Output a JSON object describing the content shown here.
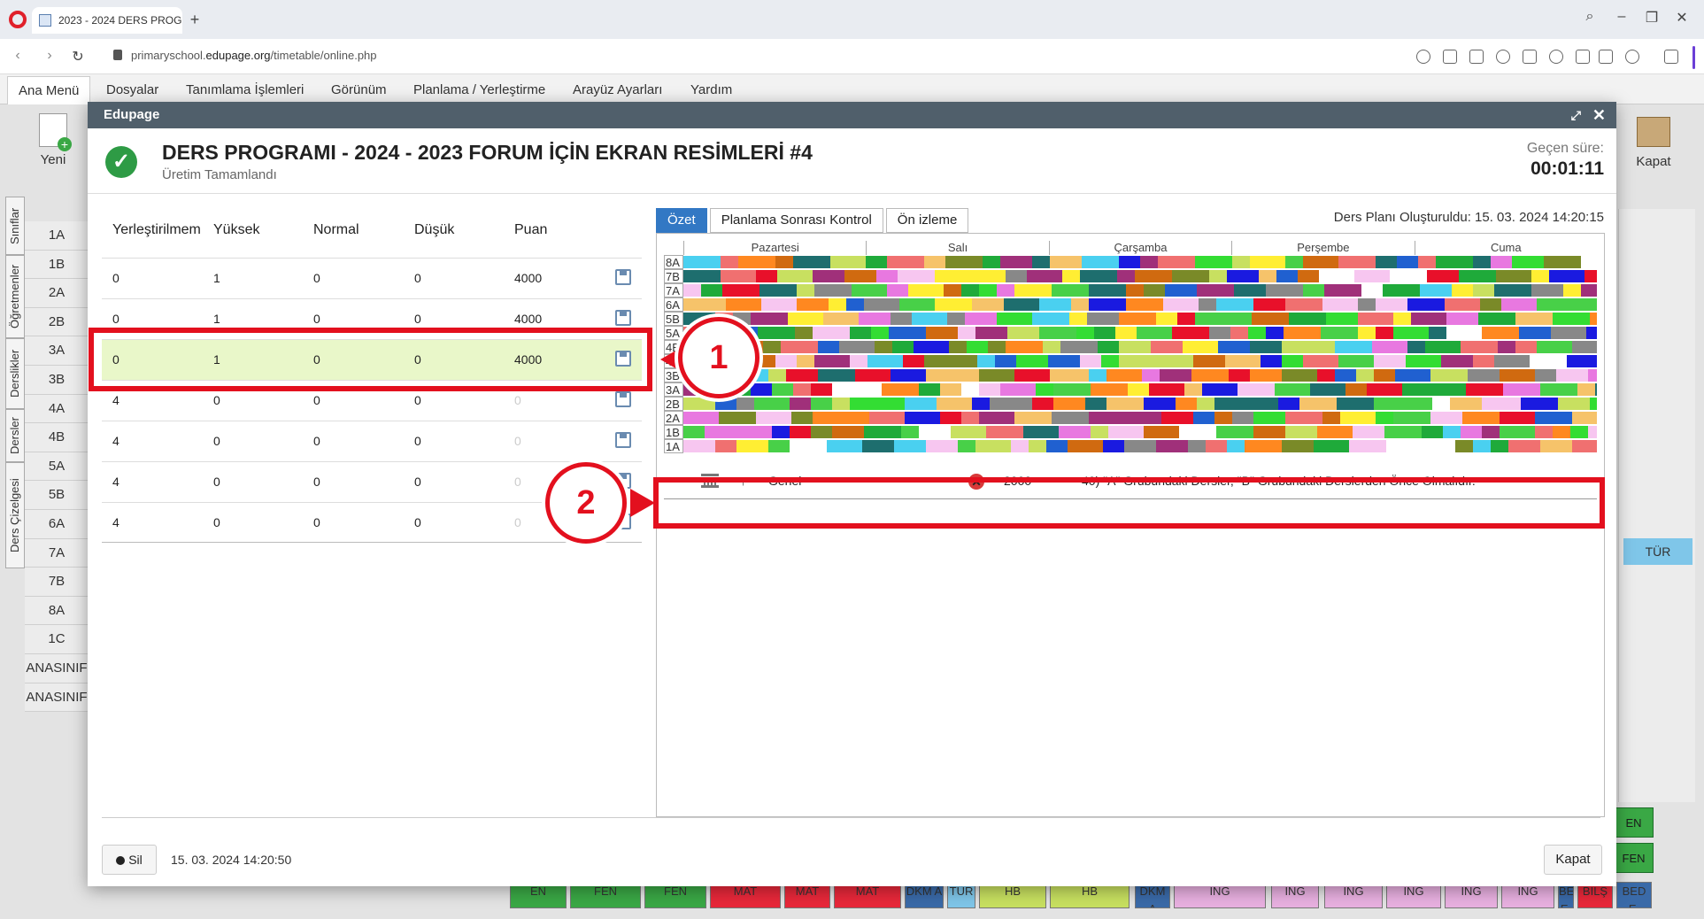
{
  "browser": {
    "tab_title": "2023 - 2024 DERS PROGR",
    "url_host": "primaryschool.",
    "url_domain": "edupage.org",
    "url_path": "/timetable/online.php"
  },
  "menu": [
    "Ana Menü",
    "Dosyalar",
    "Tanımlama İşlemleri",
    "Görünüm",
    "Planlama / Yerleştirme",
    "Arayüz Ayarları",
    "Yardım"
  ],
  "toolbar": {
    "new_label": "Yeni",
    "close_label": "Kapat"
  },
  "side_tabs": [
    "Ders Çizelgesi",
    "Dersler",
    "Derslikler",
    "Öğretmenler",
    "Sınıflar"
  ],
  "classes": [
    "1A",
    "1B",
    "2A",
    "2B",
    "3A",
    "3B",
    "4A",
    "4B",
    "5A",
    "5B",
    "6A",
    "7A",
    "7B",
    "8A",
    "1C",
    "ANASINIF",
    "ANASINIF"
  ],
  "background_cells": {
    "tur": "TÜR",
    "fen_side": [
      "EN",
      "FEN"
    ],
    "bottom": [
      "EN",
      "FEN",
      "FEN",
      "MAT",
      "MAT",
      "MAT",
      "DKM A",
      "TÜR",
      "HB",
      "HB",
      "DKM A",
      "İNG",
      "İNG",
      "İNG",
      "İNG",
      "İNG",
      "İNG",
      "BED E.",
      "BİLŞ",
      "BED E."
    ]
  },
  "modal": {
    "app_title": "Edupage",
    "title": "DERS PROGRAMI - 2024 - 2023 FORUM İÇİN EKRAN RESİMLERİ #4",
    "subtitle": "Üretim Tamamlandı",
    "elapsed_label": "Geçen süre:",
    "elapsed_value": "00:01:11",
    "results": {
      "headers": [
        "Yerleştirilmem",
        "Yüksek",
        "Normal",
        "Düşük",
        "Puan"
      ],
      "rows": [
        {
          "unplaced": "0",
          "high": "1",
          "normal": "0",
          "low": "0",
          "score": "4000"
        },
        {
          "unplaced": "0",
          "high": "1",
          "normal": "0",
          "low": "0",
          "score": "4000"
        },
        {
          "unplaced": "0",
          "high": "1",
          "normal": "0",
          "low": "0",
          "score": "4000"
        },
        {
          "unplaced": "4",
          "high": "0",
          "normal": "0",
          "low": "0",
          "score": "0"
        },
        {
          "unplaced": "4",
          "high": "0",
          "normal": "0",
          "low": "0",
          "score": "0"
        },
        {
          "unplaced": "4",
          "high": "0",
          "normal": "0",
          "low": "0",
          "score": "0"
        },
        {
          "unplaced": "4",
          "high": "0",
          "normal": "0",
          "low": "0",
          "score": "0"
        }
      ],
      "selected_row": 2
    },
    "tabs": [
      "Özet",
      "Planlama Sonrası Kontrol",
      "Ön izleme"
    ],
    "plan_created": "Ders Planı Oluşturuldu: 15. 03. 2024 14:20:15",
    "days": [
      "Pazartesi",
      "Salı",
      "Çarşamba",
      "Perşembe",
      "Cuma"
    ],
    "grid_classes": [
      "8A",
      "7B",
      "7A",
      "6A",
      "5B",
      "5A",
      "4B",
      "4A",
      "3B",
      "3A",
      "2B",
      "2A",
      "1B",
      "1A"
    ],
    "constraint": {
      "category": "Genel",
      "score": "2000",
      "description": "40) \"A\" Grubundaki Dersler, \"B\" Grubundaki Derslerden Önce Olmalıdır."
    },
    "footer": {
      "delete_label": "Sil",
      "date": "15. 03. 2024 14:20:50",
      "close_label": "Kapat"
    }
  },
  "annotations": {
    "callout_1": "1",
    "callout_2": "2"
  },
  "colors": {
    "accent": "#3278c4",
    "annotation_red": "#e3101e",
    "selected_row": "#e9f7c9",
    "success": "#2e9b45",
    "palette": [
      "#f7c6f0",
      "#1faa3a",
      "#e8102a",
      "#f6c36a",
      "#f07070",
      "#1a1ae0",
      "#33dd33",
      "#ffee33",
      "#1e6e6e",
      "#7a8a28",
      "#ff8820",
      "#4ad0f0",
      "#e878e0",
      "#2060d0",
      "#888888",
      "#c8e060",
      "#ffffff",
      "#d06a10",
      "#48d048",
      "#a0307a"
    ]
  }
}
